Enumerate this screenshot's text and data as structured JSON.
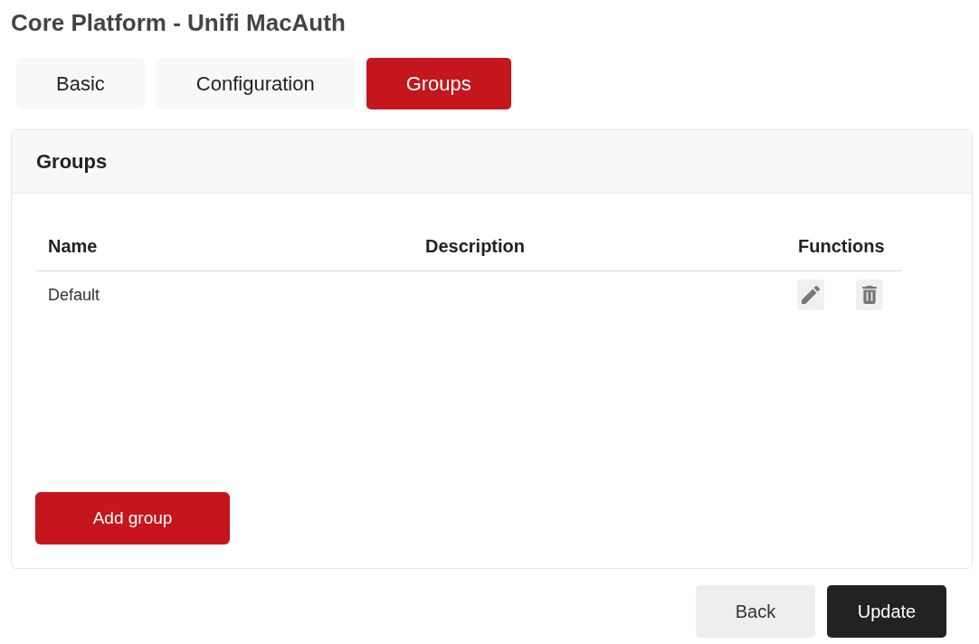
{
  "page": {
    "title": "Core Platform - Unifi MacAuth"
  },
  "tabs": [
    {
      "label": "Basic",
      "selected": false
    },
    {
      "label": "Configuration",
      "selected": false
    },
    {
      "label": "Groups",
      "selected": true
    }
  ],
  "panel": {
    "title": "Groups",
    "table": {
      "columns": [
        "Name",
        "Description",
        "Functions"
      ],
      "rows": [
        {
          "name": "Default"
        }
      ]
    },
    "add_button": "Add group"
  },
  "footer_buttons": [
    {
      "label": "Back",
      "kind": "secondary"
    },
    {
      "label": "Update",
      "kind": "primary"
    }
  ]
}
